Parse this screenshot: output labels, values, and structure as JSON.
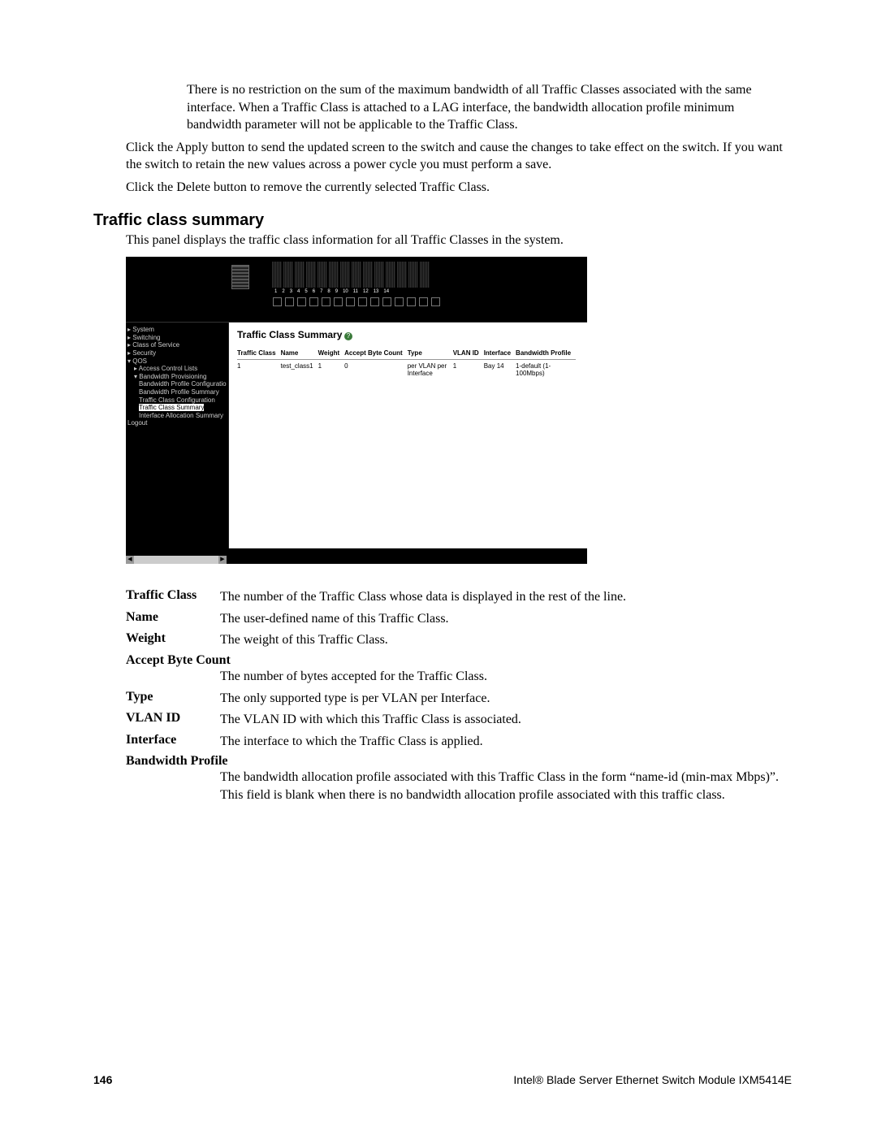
{
  "body": {
    "p1": "There is no restriction on the sum of the maximum bandwidth of all Traffic Classes associated with the same interface. When a Traffic Class is attached to a LAG interface, the bandwidth allocation profile minimum bandwidth parameter will not be applicable to the Traffic Class.",
    "p2": "Click the Apply button to send the updated screen to the switch and cause the changes to take effect on the switch. If you want the switch to retain the new values across a power cycle you must perform a save.",
    "p3": "Click the Delete button to remove the currently selected Traffic Class.",
    "section_title": "Traffic class summary",
    "p4": "This panel displays the traffic class information for all Traffic Classes in the system."
  },
  "screenshot": {
    "slot_numbers": [
      "1",
      "2",
      "3",
      "4",
      "5",
      "6",
      "7",
      "8",
      "9",
      "10",
      "11",
      "12",
      "13",
      "14"
    ],
    "nav": {
      "i0": "▸ System",
      "i1": "▸ Switching",
      "i2": "▸ Class of Service",
      "i3": "▸ Security",
      "i4": "▾ QOS",
      "i5": "▸ Access Control Lists",
      "i6": "▾ Bandwidth Provisioning",
      "i7": "Bandwidth Profile Configuration",
      "i8": "Bandwidth Profile Summary",
      "i9": "Traffic Class Configuration",
      "i10": "Traffic Class Summary",
      "i11": "Interface Allocation Summary",
      "i12": "Logout"
    },
    "main_title": "Traffic Class Summary",
    "headers": {
      "h0": "Traffic Class",
      "h1": "Name",
      "h2": "Weight",
      "h3": "Accept Byte Count",
      "h4": "Type",
      "h5": "VLAN ID",
      "h6": "Interface",
      "h7": "Bandwidth Profile"
    },
    "row": {
      "c0": "1",
      "c1": "test_class1",
      "c2": "1",
      "c3": "0",
      "c4": "per VLAN per Interface",
      "c5": "1",
      "c6": "Bay 14",
      "c7": "1-default (1-100Mbps)"
    }
  },
  "defs": {
    "t0": "Traffic Class",
    "d0": "The number of the Traffic Class whose data is displayed in the rest of the line.",
    "t1": "Name",
    "d1": "The user-defined name of this Traffic Class.",
    "t2": "Weight",
    "d2": "The weight of this Traffic Class.",
    "t3": "Accept Byte Count",
    "d3": "The number of bytes accepted for the Traffic Class.",
    "t4": "Type",
    "d4": "The only supported type is per VLAN per Interface.",
    "t5": "VLAN ID",
    "d5": "The VLAN ID with which this Traffic Class is associated.",
    "t6": "Interface",
    "d6": "The interface to which the Traffic Class is applied.",
    "t7": "Bandwidth Profile",
    "d7": "The bandwidth allocation profile associated with this Traffic Class in the form “name-id (min-max Mbps)”. This field is blank when there is no bandwidth allocation profile associated with this traffic class."
  },
  "footer": {
    "page": "146",
    "doc": "Intel® Blade Server Ethernet Switch Module IXM5414E"
  }
}
